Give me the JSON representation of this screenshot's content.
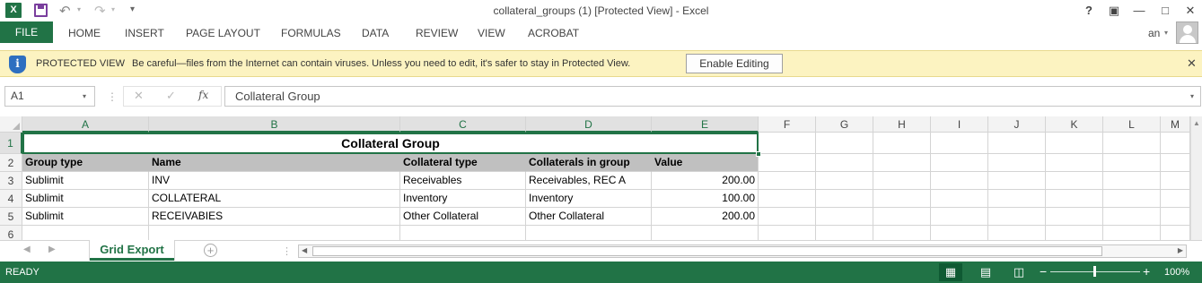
{
  "window": {
    "title": "collateral_groups (1)  [Protected View] - Excel",
    "app_icon": "X",
    "help": "?"
  },
  "ribbon": {
    "file_tab": "FILE",
    "tabs": [
      "HOME",
      "INSERT",
      "PAGE LAYOUT",
      "FORMULAS",
      "DATA",
      "REVIEW",
      "VIEW",
      "ACROBAT"
    ],
    "user": "an"
  },
  "protected_view": {
    "label": "PROTECTED VIEW",
    "message": "Be careful—files from the Internet can contain viruses. Unless you need to edit, it's safer to stay in Protected View.",
    "button": "Enable Editing",
    "shield_glyph": "i"
  },
  "formula_bar": {
    "name_box": "A1",
    "fx": "fx",
    "value": "Collateral Group"
  },
  "grid": {
    "columns": [
      "A",
      "B",
      "C",
      "D",
      "E",
      "F",
      "G",
      "H",
      "I",
      "J",
      "K",
      "L",
      "M"
    ],
    "rows": [
      "1",
      "2",
      "3",
      "4",
      "5",
      "6"
    ],
    "title": "Collateral Group",
    "headers": [
      "Group type",
      "Name",
      "Collateral type",
      "Collaterals in group",
      "Value"
    ],
    "data": [
      [
        "Sublimit",
        "INV",
        "Receivables",
        "Receivables, REC A",
        "200.00"
      ],
      [
        "Sublimit",
        "COLLATERAL",
        "Inventory",
        "Inventory",
        "100.00"
      ],
      [
        "Sublimit",
        "RECEIVABIES",
        "Other Collateral",
        "Other Collateral",
        "200.00"
      ]
    ],
    "header_fill": "#c0c0c0",
    "selection_color": "#217346"
  },
  "sheets": {
    "active": "Grid Export"
  },
  "status": {
    "ready": "READY",
    "zoom": "100%"
  },
  "colors": {
    "excel_green": "#217346",
    "protected_bar": "#fcf3c1"
  }
}
